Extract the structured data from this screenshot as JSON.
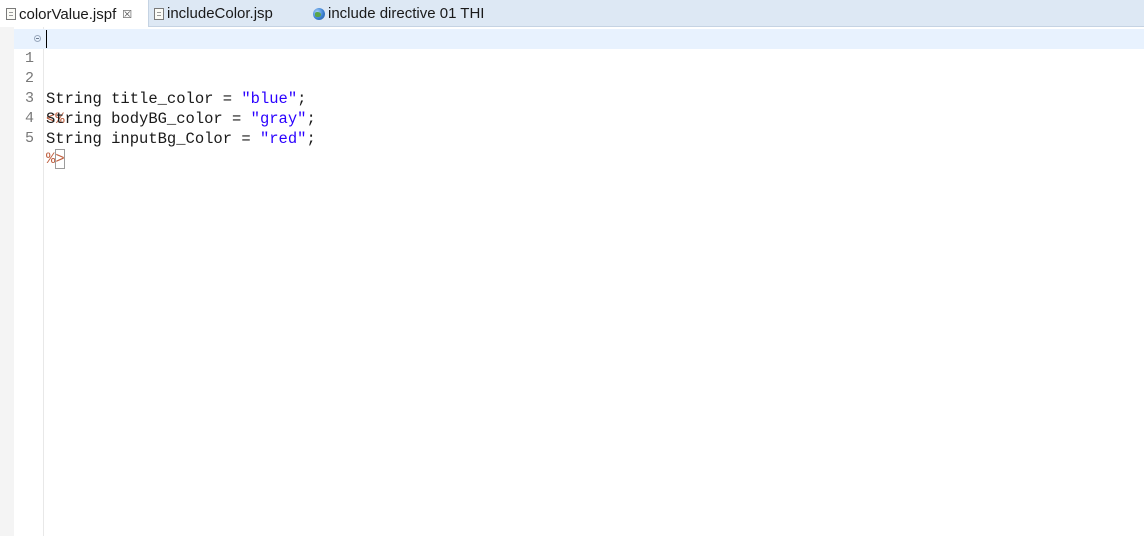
{
  "tabs": [
    {
      "label": "colorValue.jspf",
      "close": "☒",
      "icon": "jsp-file-icon"
    },
    {
      "label": "includeColor.jsp",
      "icon": "jsp-file-icon"
    },
    {
      "label": "include directive 01 THI",
      "icon": "globe-icon"
    }
  ],
  "editor": {
    "line_numbers": [
      "1",
      "2",
      "3",
      "4",
      "5"
    ],
    "lines": [
      {
        "open_tag": "<%"
      },
      {
        "keyword": "String",
        "var": " title_color = ",
        "value": "\"blue\"",
        "end": ";"
      },
      {
        "keyword": "String",
        "var": " bodyBG_color = ",
        "value": "\"gray\"",
        "end": ";"
      },
      {
        "keyword": "String",
        "var": " inputBg_Color = ",
        "value": "\"red\"",
        "end": ";"
      },
      {
        "close_pct": "%",
        "close_gt": ">"
      }
    ]
  }
}
